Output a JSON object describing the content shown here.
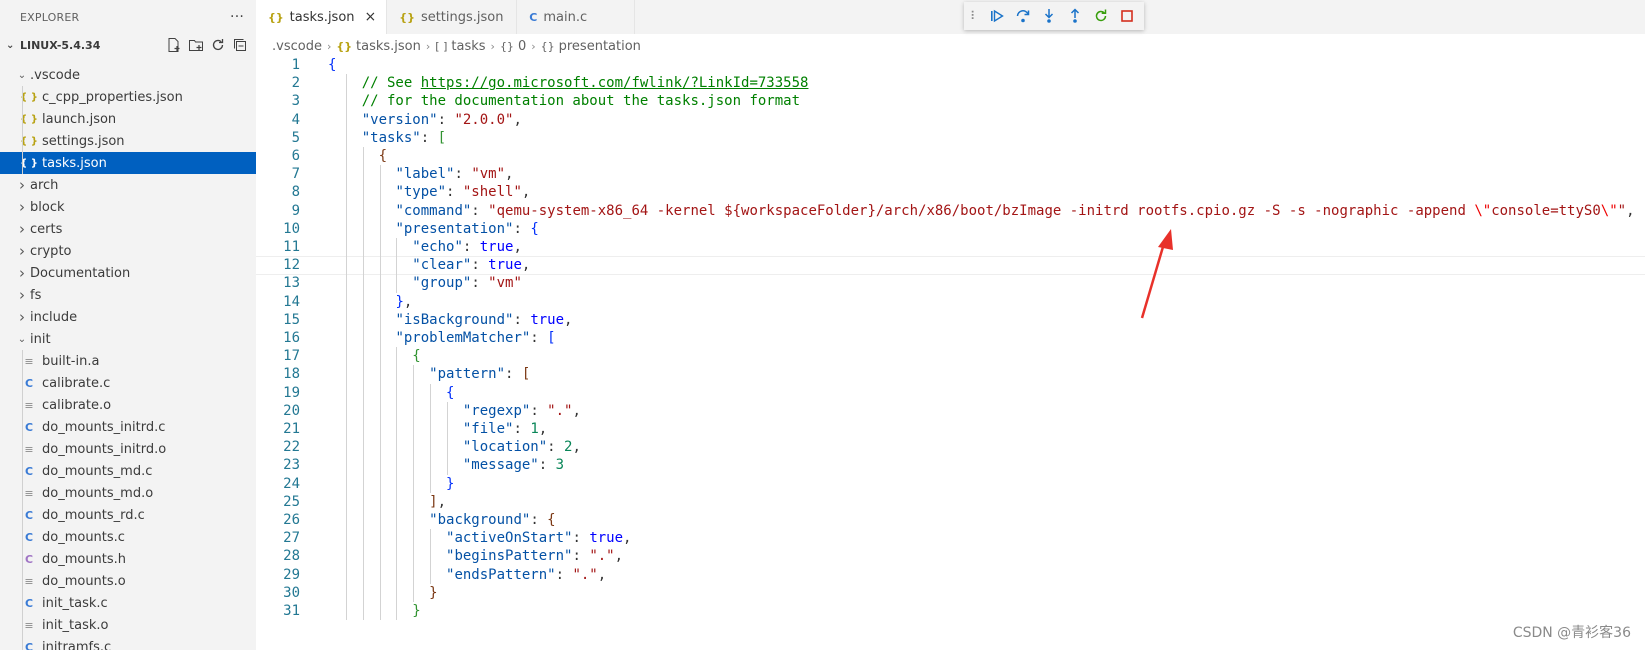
{
  "sidebar": {
    "title": "EXPLORER",
    "more": "···",
    "project": "LINUX-5.4.34",
    "actions": [
      "new-file-icon",
      "new-folder-icon",
      "refresh-icon",
      "collapse-all-icon"
    ],
    "tree": [
      {
        "label": ".vscode",
        "type": "folder-open",
        "depth": 0
      },
      {
        "label": "c_cpp_properties.json",
        "type": "json",
        "depth": 1
      },
      {
        "label": "launch.json",
        "type": "json",
        "depth": 1
      },
      {
        "label": "settings.json",
        "type": "json",
        "depth": 1
      },
      {
        "label": "tasks.json",
        "type": "json",
        "depth": 1,
        "selected": true
      },
      {
        "label": "arch",
        "type": "folder",
        "depth": 0
      },
      {
        "label": "block",
        "type": "folder",
        "depth": 0
      },
      {
        "label": "certs",
        "type": "folder",
        "depth": 0
      },
      {
        "label": "crypto",
        "type": "folder",
        "depth": 0
      },
      {
        "label": "Documentation",
        "type": "folder",
        "depth": 0
      },
      {
        "label": "fs",
        "type": "folder",
        "depth": 0
      },
      {
        "label": "include",
        "type": "folder",
        "depth": 0
      },
      {
        "label": "init",
        "type": "folder-open",
        "depth": 0
      },
      {
        "label": "built-in.a",
        "type": "o",
        "depth": 1
      },
      {
        "label": "calibrate.c",
        "type": "c",
        "depth": 1
      },
      {
        "label": "calibrate.o",
        "type": "o",
        "depth": 1
      },
      {
        "label": "do_mounts_initrd.c",
        "type": "c",
        "depth": 1
      },
      {
        "label": "do_mounts_initrd.o",
        "type": "o",
        "depth": 1
      },
      {
        "label": "do_mounts_md.c",
        "type": "c",
        "depth": 1
      },
      {
        "label": "do_mounts_md.o",
        "type": "o",
        "depth": 1
      },
      {
        "label": "do_mounts_rd.c",
        "type": "c",
        "depth": 1
      },
      {
        "label": "do_mounts.c",
        "type": "c",
        "depth": 1
      },
      {
        "label": "do_mounts.h",
        "type": "h",
        "depth": 1
      },
      {
        "label": "do_mounts.o",
        "type": "o",
        "depth": 1
      },
      {
        "label": "init_task.c",
        "type": "c",
        "depth": 1
      },
      {
        "label": "init_task.o",
        "type": "o",
        "depth": 1
      },
      {
        "label": "initramfs.c",
        "type": "c",
        "depth": 1
      }
    ]
  },
  "tabs": [
    {
      "label": "tasks.json",
      "icon": "{}",
      "active": true,
      "close": "×"
    },
    {
      "label": "settings.json",
      "icon": "{}",
      "active": false
    },
    {
      "label": "main.c",
      "icon": "C",
      "active": false
    }
  ],
  "debug_toolbar": [
    "grip-icon",
    "continue-icon",
    "step-over-icon",
    "step-into-icon",
    "step-out-icon",
    "restart-icon",
    "stop-icon"
  ],
  "breadcrumb": [
    {
      "label": ".vscode",
      "icon": ""
    },
    {
      "label": "tasks.json",
      "icon": "{}"
    },
    {
      "label": "tasks",
      "icon": "[ ]"
    },
    {
      "label": "0",
      "icon": "{}"
    },
    {
      "label": "presentation",
      "icon": "{}"
    }
  ],
  "editor": {
    "current_line": 12,
    "lines": [
      [
        0,
        [
          [
            "br1",
            "{"
          ]
        ]
      ],
      [
        2,
        [
          [
            "cm",
            "// See "
          ],
          [
            "link",
            "https://go.microsoft.com/fwlink/?LinkId=733558"
          ]
        ]
      ],
      [
        2,
        [
          [
            "cm",
            "// for the documentation about the tasks.json format"
          ]
        ]
      ],
      [
        2,
        [
          [
            "key",
            "\"version\""
          ],
          [
            "p",
            ": "
          ],
          [
            "str",
            "\"2.0.0\""
          ],
          [
            "p",
            ","
          ]
        ]
      ],
      [
        2,
        [
          [
            "key",
            "\"tasks\""
          ],
          [
            "p",
            ": "
          ],
          [
            "br2",
            "["
          ]
        ]
      ],
      [
        3,
        [
          [
            "br3",
            "{"
          ]
        ]
      ],
      [
        4,
        [
          [
            "key",
            "\"label\""
          ],
          [
            "p",
            ": "
          ],
          [
            "str",
            "\"vm\""
          ],
          [
            "p",
            ","
          ]
        ]
      ],
      [
        4,
        [
          [
            "key",
            "\"type\""
          ],
          [
            "p",
            ": "
          ],
          [
            "str",
            "\"shell\""
          ],
          [
            "p",
            ","
          ]
        ]
      ],
      [
        4,
        [
          [
            "key",
            "\"command\""
          ],
          [
            "p",
            ": "
          ],
          [
            "str",
            "\"qemu-system-x86_64 -kernel ${workspaceFolder}/arch/x86/boot/bzImage -initrd rootfs.cpio.gz -S -s -nographic -append "
          ],
          [
            "esc",
            "\\\""
          ],
          [
            "str",
            "console=ttyS0"
          ],
          [
            "esc",
            "\\\""
          ],
          [
            "str",
            "\""
          ],
          [
            "p",
            ","
          ]
        ]
      ],
      [
        4,
        [
          [
            "key",
            "\"presentation\""
          ],
          [
            "p",
            ": "
          ],
          [
            "br1",
            "{"
          ]
        ]
      ],
      [
        5,
        [
          [
            "key",
            "\"echo\""
          ],
          [
            "p",
            ": "
          ],
          [
            "kw",
            "true"
          ],
          [
            "p",
            ","
          ]
        ]
      ],
      [
        5,
        [
          [
            "key",
            "\"clear\""
          ],
          [
            "p",
            ": "
          ],
          [
            "kw",
            "true"
          ],
          [
            "p",
            ","
          ]
        ]
      ],
      [
        5,
        [
          [
            "key",
            "\"group\""
          ],
          [
            "p",
            ": "
          ],
          [
            "str",
            "\"vm\""
          ]
        ]
      ],
      [
        4,
        [
          [
            "br1",
            "}"
          ],
          [
            "p",
            ","
          ]
        ]
      ],
      [
        4,
        [
          [
            "key",
            "\"isBackground\""
          ],
          [
            "p",
            ": "
          ],
          [
            "kw",
            "true"
          ],
          [
            "p",
            ","
          ]
        ]
      ],
      [
        4,
        [
          [
            "key",
            "\"problemMatcher\""
          ],
          [
            "p",
            ": "
          ],
          [
            "br1",
            "["
          ]
        ]
      ],
      [
        5,
        [
          [
            "br2",
            "{"
          ]
        ]
      ],
      [
        6,
        [
          [
            "key",
            "\"pattern\""
          ],
          [
            "p",
            ": "
          ],
          [
            "br3",
            "["
          ]
        ]
      ],
      [
        7,
        [
          [
            "br1",
            "{"
          ]
        ]
      ],
      [
        8,
        [
          [
            "key",
            "\"regexp\""
          ],
          [
            "p",
            ": "
          ],
          [
            "str",
            "\".\""
          ],
          [
            "p",
            ","
          ]
        ]
      ],
      [
        8,
        [
          [
            "key",
            "\"file\""
          ],
          [
            "p",
            ": "
          ],
          [
            "num",
            "1"
          ],
          [
            "p",
            ","
          ]
        ]
      ],
      [
        8,
        [
          [
            "key",
            "\"location\""
          ],
          [
            "p",
            ": "
          ],
          [
            "num",
            "2"
          ],
          [
            "p",
            ","
          ]
        ]
      ],
      [
        8,
        [
          [
            "key",
            "\"message\""
          ],
          [
            "p",
            ": "
          ],
          [
            "num",
            "3"
          ]
        ]
      ],
      [
        7,
        [
          [
            "br1",
            "}"
          ]
        ]
      ],
      [
        6,
        [
          [
            "br3",
            "]"
          ],
          [
            "p",
            ","
          ]
        ]
      ],
      [
        6,
        [
          [
            "key",
            "\"background\""
          ],
          [
            "p",
            ": "
          ],
          [
            "br3",
            "{"
          ]
        ]
      ],
      [
        7,
        [
          [
            "key",
            "\"activeOnStart\""
          ],
          [
            "p",
            ": "
          ],
          [
            "kw",
            "true"
          ],
          [
            "p",
            ","
          ]
        ]
      ],
      [
        7,
        [
          [
            "key",
            "\"beginsPattern\""
          ],
          [
            "p",
            ": "
          ],
          [
            "str",
            "\".\""
          ],
          [
            "p",
            ","
          ]
        ]
      ],
      [
        7,
        [
          [
            "key",
            "\"endsPattern\""
          ],
          [
            "p",
            ": "
          ],
          [
            "str",
            "\".\""
          ],
          [
            "p",
            ","
          ]
        ]
      ],
      [
        6,
        [
          [
            "br3",
            "}"
          ]
        ]
      ],
      [
        5,
        [
          [
            "br2",
            "}"
          ]
        ]
      ]
    ]
  },
  "watermark": "CSDN @青衫客36",
  "colors": {
    "selection": "#0060c0",
    "arrow": "#e8312a"
  }
}
